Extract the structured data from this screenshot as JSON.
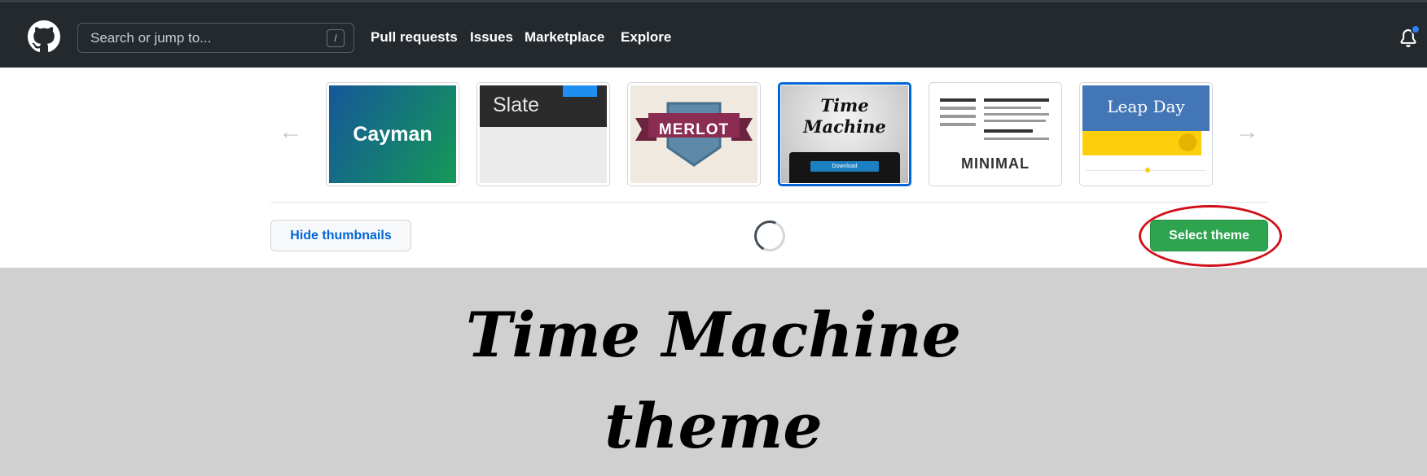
{
  "header": {
    "search_placeholder": "Search or jump to...",
    "search_shortcut": "/",
    "nav": [
      "Pull requests",
      "Issues",
      "Marketplace",
      "Explore"
    ],
    "notification_indicator": true
  },
  "themes": [
    {
      "name": "Cayman",
      "label": "Cayman"
    },
    {
      "name": "Slate",
      "label": "Slate"
    },
    {
      "name": "Merlot",
      "label": "MERLOT"
    },
    {
      "name": "Time Machine",
      "label_line1": "Time",
      "label_line2": "Machine",
      "button": "Download",
      "selected": true
    },
    {
      "name": "Minimal",
      "label": "MINIMAL"
    },
    {
      "name": "Leap Day",
      "label": "Leap Day"
    }
  ],
  "actions": {
    "hide_thumbnails": "Hide thumbnails",
    "select_theme": "Select theme"
  },
  "preview": {
    "title_line1": "Time Machine",
    "title_line2": "theme"
  },
  "colors": {
    "header_bg": "#24292e",
    "selected_border": "#0366d6",
    "primary_button": "#2ea44f",
    "annotation": "#d0101a",
    "preview_bg": "#d0d0d0"
  },
  "icons": [
    "github-logo-icon",
    "arrow-left-icon",
    "arrow-right-icon",
    "bell-icon",
    "loading-spinner-icon",
    "octocat-icon"
  ]
}
